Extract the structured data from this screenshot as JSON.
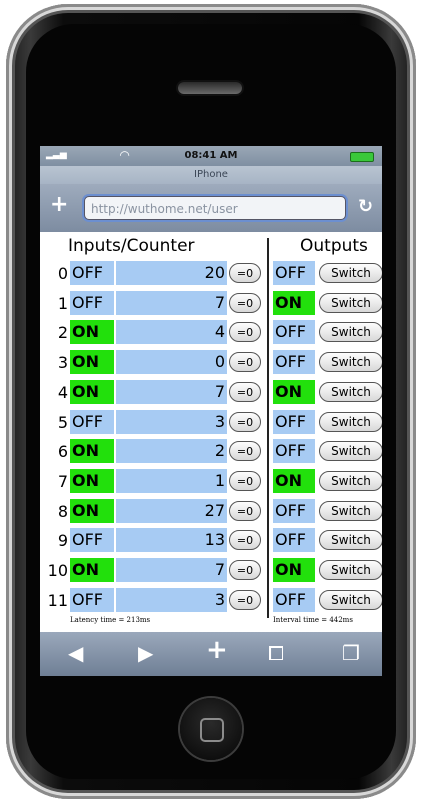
{
  "status": {
    "time": "08:41 AM",
    "signal": ".atll",
    "wifi": "wifi",
    "battery": "battery"
  },
  "page_title": "IPhone",
  "url": "http://wuthome.net/user",
  "headers": {
    "inputs": "Inputs/Counter",
    "outputs": "Outputs"
  },
  "rows": [
    {
      "index": "0",
      "input": "OFF",
      "count": "20",
      "reset": "=0",
      "output": "OFF",
      "switch": "Switch"
    },
    {
      "index": "1",
      "input": "OFF",
      "count": "7",
      "reset": "=0",
      "output": "ON",
      "switch": "Switch"
    },
    {
      "index": "2",
      "input": "ON",
      "count": "4",
      "reset": "=0",
      "output": "OFF",
      "switch": "Switch"
    },
    {
      "index": "3",
      "input": "ON",
      "count": "0",
      "reset": "=0",
      "output": "OFF",
      "switch": "Switch"
    },
    {
      "index": "4",
      "input": "ON",
      "count": "7",
      "reset": "=0",
      "output": "ON",
      "switch": "Switch"
    },
    {
      "index": "5",
      "input": "OFF",
      "count": "3",
      "reset": "=0",
      "output": "OFF",
      "switch": "Switch"
    },
    {
      "index": "6",
      "input": "ON",
      "count": "2",
      "reset": "=0",
      "output": "OFF",
      "switch": "Switch"
    },
    {
      "index": "7",
      "input": "ON",
      "count": "1",
      "reset": "=0",
      "output": "ON",
      "switch": "Switch"
    },
    {
      "index": "8",
      "input": "ON",
      "count": "27",
      "reset": "=0",
      "output": "OFF",
      "switch": "Switch"
    },
    {
      "index": "9",
      "input": "OFF",
      "count": "13",
      "reset": "=0",
      "output": "OFF",
      "switch": "Switch"
    },
    {
      "index": "10",
      "input": "ON",
      "count": "7",
      "reset": "=0",
      "output": "ON",
      "switch": "Switch"
    },
    {
      "index": "11",
      "input": "OFF",
      "count": "3",
      "reset": "=0",
      "output": "OFF",
      "switch": "Switch"
    }
  ],
  "footer": {
    "latency": "Latency time = 213ms",
    "interval": "Interval time = 442ms"
  },
  "toolbar_icons": [
    "back-icon",
    "forward-icon",
    "add-icon",
    "bookmarks-icon",
    "pages-icon"
  ],
  "colors": {
    "on": "#22e00c",
    "off": "#a7cbf3"
  }
}
